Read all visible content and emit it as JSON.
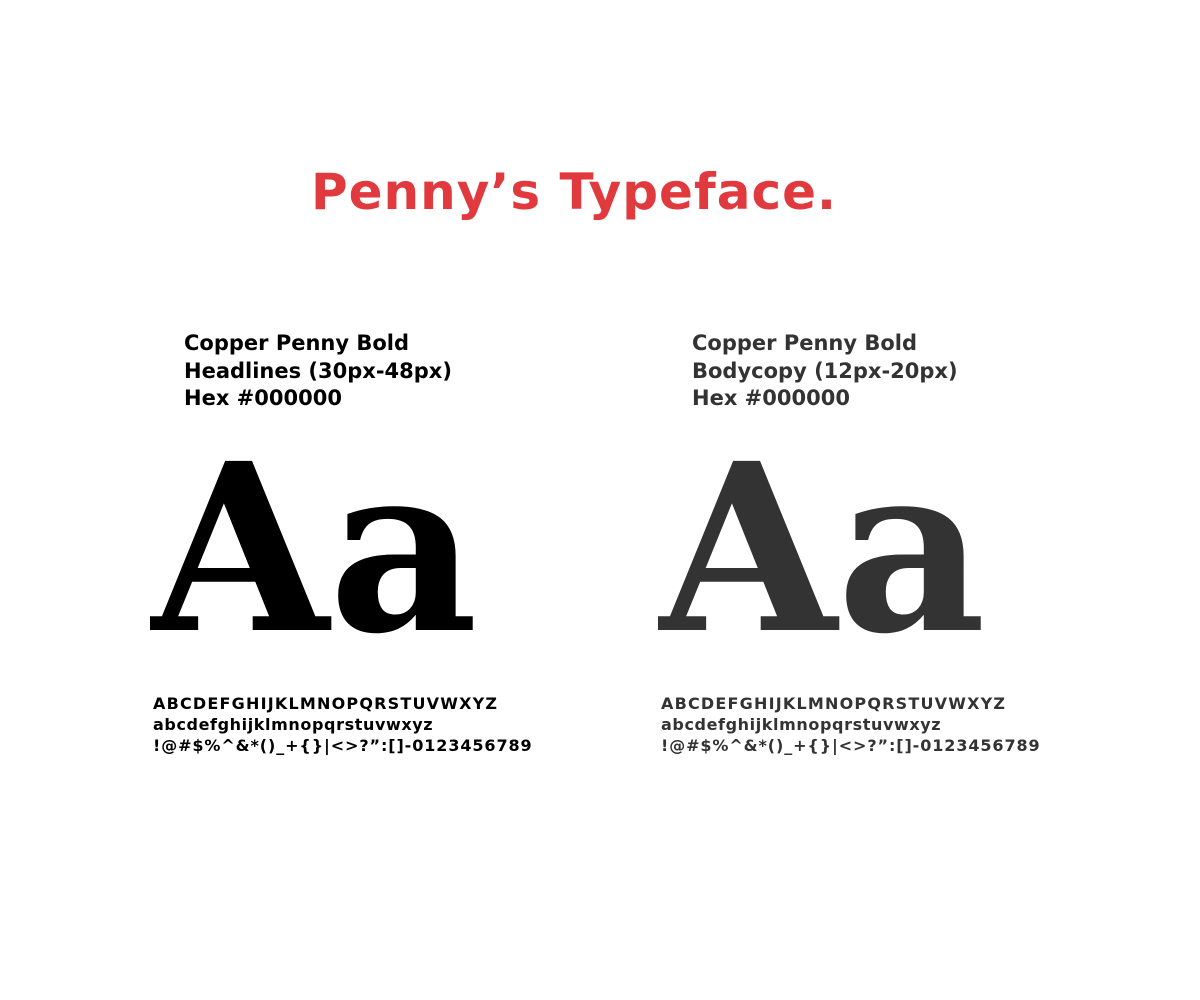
{
  "title": "Penny’s Typeface.",
  "colors": {
    "accent": "#e03a3e",
    "headline": "#000000",
    "body": "#333333"
  },
  "columns": [
    {
      "name_line": "Copper Penny Bold",
      "usage_line": "Headlines (30px-48px)",
      "hex_line": "Hex #000000",
      "sample": "Aa",
      "uppercase": "ABCDEFGHIJKLMNOPQRSTUVWXYZ",
      "lowercase": "abcdefghijklmnopqrstuvwxyz",
      "symbols": "!@#$%^&*()_+{}|<>?”:[]-0123456789"
    },
    {
      "name_line": "Copper Penny Bold",
      "usage_line": "Bodycopy (12px-20px)",
      "hex_line": "Hex #000000",
      "sample": "Aa",
      "uppercase": "ABCDEFGHIJKLMNOPQRSTUVWXYZ",
      "lowercase": "abcdefghijklmnopqrstuvwxyz",
      "symbols": "!@#$%^&*()_+{}|<>?”:[]-0123456789"
    }
  ]
}
